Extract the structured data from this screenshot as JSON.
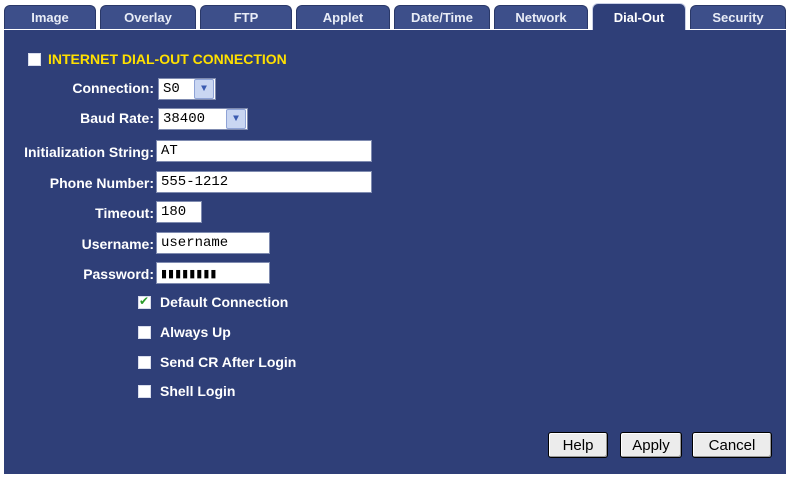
{
  "tabs": [
    {
      "label": "Image"
    },
    {
      "label": "Overlay"
    },
    {
      "label": "FTP"
    },
    {
      "label": "Applet"
    },
    {
      "label": "Date/Time"
    },
    {
      "label": "Network"
    },
    {
      "label": "Dial-Out",
      "active": true
    },
    {
      "label": "Security"
    }
  ],
  "form": {
    "section_title": "INTERNET DIAL-OUT CONNECTION",
    "section_checked": false,
    "connection": {
      "label": "Connection:",
      "value": "S0"
    },
    "baud_rate": {
      "label": "Baud Rate:",
      "value": "38400"
    },
    "init_string": {
      "label": "Initialization String:",
      "value": "AT"
    },
    "phone_number": {
      "label": "Phone Number:",
      "value": "555-1212"
    },
    "timeout": {
      "label": "Timeout:",
      "value": "180"
    },
    "username": {
      "label": "Username:",
      "value": "username"
    },
    "password": {
      "label": "Password:",
      "value": "▮▮▮▮▮▮▮▮"
    },
    "options": [
      {
        "label": "Default Connection",
        "checked": true
      },
      {
        "label": "Always Up",
        "checked": false
      },
      {
        "label": "Send CR After Login",
        "checked": false
      },
      {
        "label": "Shell Login",
        "checked": false
      }
    ]
  },
  "buttons": {
    "help": "Help",
    "apply": "Apply",
    "cancel": "Cancel"
  },
  "colors": {
    "panel_bg": "#2f3f78",
    "tab_bg": "#3d4f8a",
    "section_title": "#ffe000",
    "check_mark": "#2a9a2a"
  }
}
